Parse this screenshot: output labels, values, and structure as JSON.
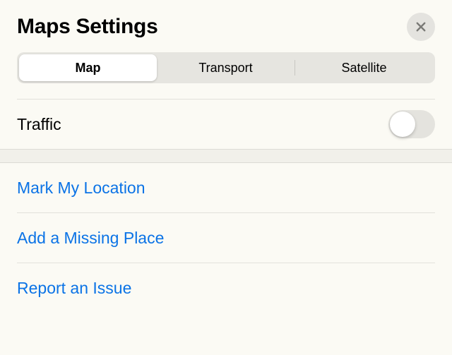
{
  "header": {
    "title": "Maps Settings"
  },
  "tabs": {
    "items": [
      {
        "label": "Map",
        "selected": true
      },
      {
        "label": "Transport",
        "selected": false
      },
      {
        "label": "Satellite",
        "selected": false
      }
    ]
  },
  "settings": {
    "traffic": {
      "label": "Traffic",
      "enabled": false
    }
  },
  "actions": {
    "mark_location": "Mark My Location",
    "add_missing_place": "Add a Missing Place",
    "report_issue": "Report an Issue"
  }
}
